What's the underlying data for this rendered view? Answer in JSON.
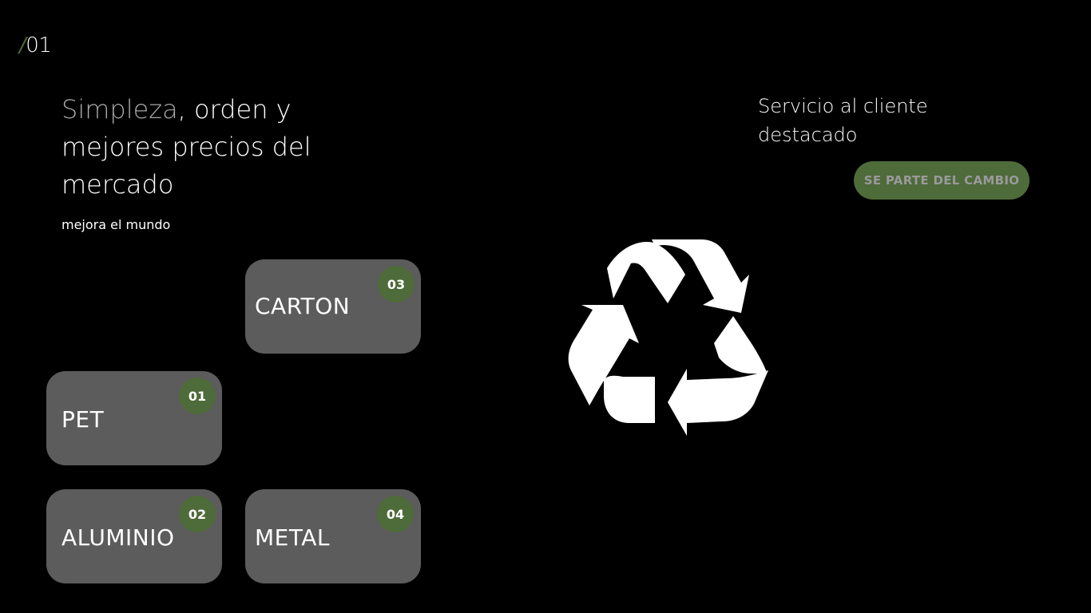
{
  "slide": {
    "slash": "/",
    "number": "01"
  },
  "headline": {
    "highlight": "Simpleza",
    "rest": ", orden y mejores precios del mercado"
  },
  "subline": "mejora el mundo",
  "cards": [
    {
      "label": "PET",
      "badge": "01"
    },
    {
      "label": "ALUMINIO",
      "badge": "02"
    },
    {
      "label": "CARTON",
      "badge": "03"
    },
    {
      "label": "METAL",
      "badge": "04"
    }
  ],
  "service": {
    "text": "Servicio al cliente destacado"
  },
  "cta": {
    "label": "SE PARTE DEL CAMBIO"
  },
  "icons": {
    "recycle": "recycle-icon"
  },
  "colors": {
    "background": "#000000",
    "accent_green": "#4e6b3a",
    "card_gray": "#5c5c5c",
    "muted_text": "#a8a8a8"
  }
}
